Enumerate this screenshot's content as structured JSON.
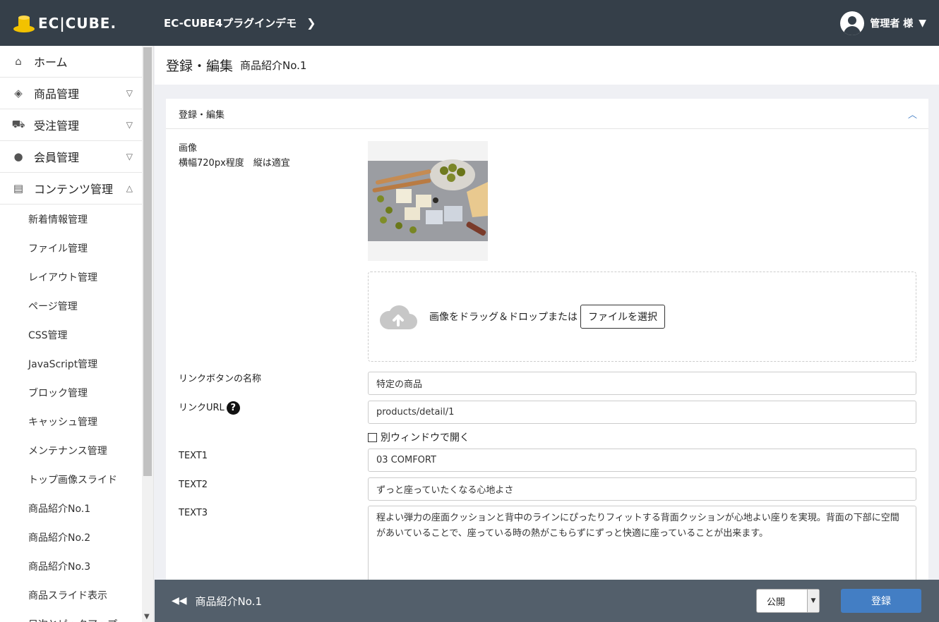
{
  "header": {
    "logo_text": "EC|CUBE.",
    "shop_name": "EC-CUBE4プラグインデモ",
    "user_name": "管理者 様"
  },
  "sidebar": {
    "items": [
      {
        "label": "ホーム",
        "icon": "home-icon"
      },
      {
        "label": "商品管理",
        "icon": "box-icon"
      },
      {
        "label": "受注管理",
        "icon": "cart-icon"
      },
      {
        "label": "会員管理",
        "icon": "users-icon"
      },
      {
        "label": "コンテンツ管理",
        "icon": "document-icon"
      }
    ],
    "sub_items": [
      "新着情報管理",
      "ファイル管理",
      "レイアウト管理",
      "ページ管理",
      "CSS管理",
      "JavaScript管理",
      "ブロック管理",
      "キャッシュ管理",
      "メンテナンス管理",
      "トップ画像スライド",
      "商品紹介No.1",
      "商品紹介No.2",
      "商品紹介No.3",
      "商品スライド表示",
      "目次とピックアップ"
    ]
  },
  "page": {
    "title": "登録・編集",
    "subtitle": "商品紹介No.1"
  },
  "card": {
    "title": "登録・編集",
    "image_label": "画像",
    "image_hint": "横幅720px程度　縦は適宜",
    "dropzone_text": "画像をドラッグ＆ドロップまたは",
    "file_button": "ファイルを選択",
    "link_name_label": "リンクボタンの名称",
    "link_name_value": "特定の商品",
    "link_url_label": "リンクURL",
    "link_url_value": "products/detail/1",
    "new_window_label": "別ウィンドウで開く",
    "text1_label": "TEXT1",
    "text1_value": "03 COMFORT",
    "text2_label": "TEXT2",
    "text2_value": "ずっと座っていたくなる心地よさ",
    "text3_label": "TEXT3",
    "text3_value": "程よい弾力の座面クッションと背中のラインにぴったりフィットする背面クッションが心地よい座りを実現。背面の下部に空間があいていることで、座っている時の熱がこもらずにずっと快適に座っていることが出来ます。"
  },
  "footer": {
    "back_label": "商品紹介No.1",
    "status_value": "公開",
    "save_label": "登録"
  },
  "colors": {
    "header_bg": "#353f49",
    "footer_bg": "#535f6b",
    "accent": "#437ec4"
  }
}
